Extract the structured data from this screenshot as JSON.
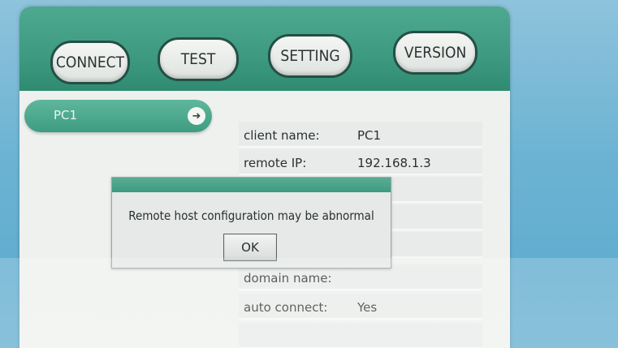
{
  "toolbar": {
    "connect_label": "CONNECT",
    "test_label": "TEST",
    "setting_label": "SETTING",
    "version_label": "VERSION"
  },
  "sidebar": {
    "items": [
      {
        "label": "PC1",
        "icon": "arrow-right-icon"
      }
    ]
  },
  "info": {
    "rows": [
      {
        "key": "client name:",
        "value": "PC1"
      },
      {
        "key": "remote IP:",
        "value": "192.168.1.3"
      },
      {
        "key": "",
        "value": ""
      },
      {
        "key": "",
        "value": ""
      },
      {
        "key": "",
        "value": ""
      },
      {
        "key": "domain name:",
        "value": ""
      },
      {
        "key": "auto connect:",
        "value": "Yes"
      },
      {
        "key": "",
        "value": ""
      }
    ]
  },
  "dialog": {
    "message": "Remote host configuration may be abnormal",
    "ok_label": "OK"
  },
  "colors": {
    "accent": "#3e9c80",
    "toolbar_border": "#244f45",
    "panel_bg": "#eef1ee"
  }
}
